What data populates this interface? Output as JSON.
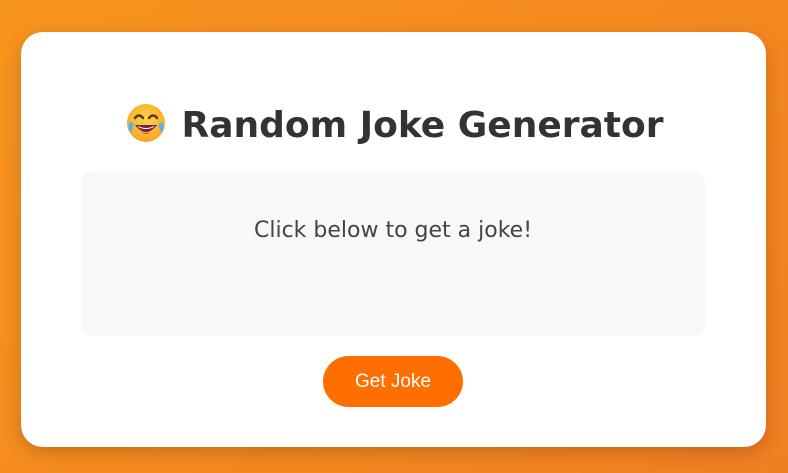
{
  "app": {
    "title": "Random Joke Generator",
    "title_icon": "laughing-tears-emoji",
    "joke_text": "Click below to get a joke!",
    "button_label": "Get Joke"
  },
  "colors": {
    "background_gradient_start": "#f7941d",
    "background_gradient_end": "#f07f22",
    "card": "#ffffff",
    "joke_box": "#f8f8f8",
    "button": "#ff6f00",
    "title_text": "#333333",
    "joke_text": "#444444"
  }
}
